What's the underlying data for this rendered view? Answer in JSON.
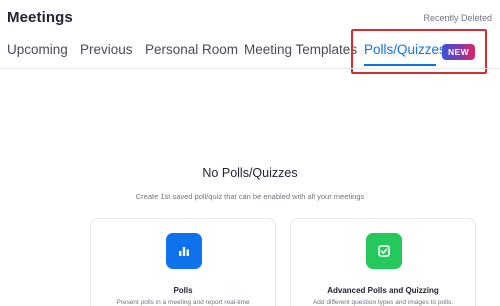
{
  "header": {
    "title": "Meetings",
    "recently_deleted": "Recently Deleted"
  },
  "tabs": [
    {
      "label": "Upcoming",
      "active": false
    },
    {
      "label": "Previous",
      "active": false
    },
    {
      "label": "Personal Room",
      "active": false
    },
    {
      "label": "Meeting Templates",
      "active": false
    },
    {
      "label": "Polls/Quizzes",
      "active": true,
      "badge": "NEW"
    }
  ],
  "empty_state": {
    "title": "No Polls/Quizzes",
    "subtitle": "Create 1st saved poll/quiz that can be enabled with all your meetings"
  },
  "cards": [
    {
      "title": "Polls",
      "description": "Present polls in a meeting and report real-time",
      "icon": "bar-chart-icon",
      "color": "#0e72ed"
    },
    {
      "title": "Advanced Polls and Quizzing",
      "description": "Add different question types and images to polls.",
      "icon": "checkbox-icon",
      "color": "#25c95b"
    }
  ],
  "colors": {
    "accent": "#0e72ed",
    "highlight": "#d32f2f"
  }
}
